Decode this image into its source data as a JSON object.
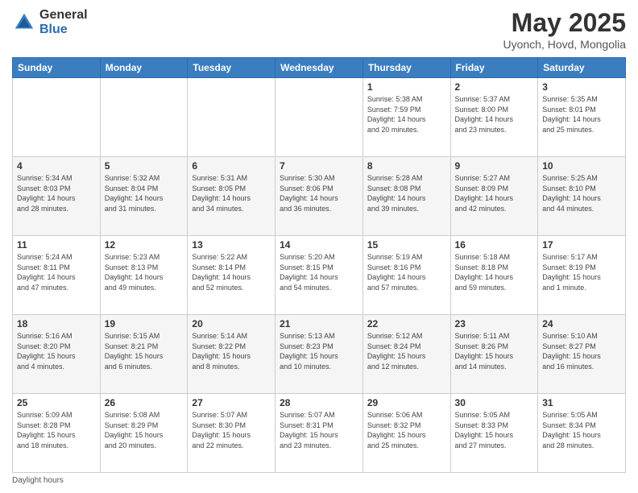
{
  "header": {
    "logo_general": "General",
    "logo_blue": "Blue",
    "title": "May 2025",
    "location": "Uyonch, Hovd, Mongolia"
  },
  "weekdays": [
    "Sunday",
    "Monday",
    "Tuesday",
    "Wednesday",
    "Thursday",
    "Friday",
    "Saturday"
  ],
  "footer": "Daylight hours",
  "weeks": [
    [
      {
        "day": "",
        "info": ""
      },
      {
        "day": "",
        "info": ""
      },
      {
        "day": "",
        "info": ""
      },
      {
        "day": "",
        "info": ""
      },
      {
        "day": "1",
        "info": "Sunrise: 5:38 AM\nSunset: 7:59 PM\nDaylight: 14 hours\nand 20 minutes."
      },
      {
        "day": "2",
        "info": "Sunrise: 5:37 AM\nSunset: 8:00 PM\nDaylight: 14 hours\nand 23 minutes."
      },
      {
        "day": "3",
        "info": "Sunrise: 5:35 AM\nSunset: 8:01 PM\nDaylight: 14 hours\nand 25 minutes."
      }
    ],
    [
      {
        "day": "4",
        "info": "Sunrise: 5:34 AM\nSunset: 8:03 PM\nDaylight: 14 hours\nand 28 minutes."
      },
      {
        "day": "5",
        "info": "Sunrise: 5:32 AM\nSunset: 8:04 PM\nDaylight: 14 hours\nand 31 minutes."
      },
      {
        "day": "6",
        "info": "Sunrise: 5:31 AM\nSunset: 8:05 PM\nDaylight: 14 hours\nand 34 minutes."
      },
      {
        "day": "7",
        "info": "Sunrise: 5:30 AM\nSunset: 8:06 PM\nDaylight: 14 hours\nand 36 minutes."
      },
      {
        "day": "8",
        "info": "Sunrise: 5:28 AM\nSunset: 8:08 PM\nDaylight: 14 hours\nand 39 minutes."
      },
      {
        "day": "9",
        "info": "Sunrise: 5:27 AM\nSunset: 8:09 PM\nDaylight: 14 hours\nand 42 minutes."
      },
      {
        "day": "10",
        "info": "Sunrise: 5:25 AM\nSunset: 8:10 PM\nDaylight: 14 hours\nand 44 minutes."
      }
    ],
    [
      {
        "day": "11",
        "info": "Sunrise: 5:24 AM\nSunset: 8:11 PM\nDaylight: 14 hours\nand 47 minutes."
      },
      {
        "day": "12",
        "info": "Sunrise: 5:23 AM\nSunset: 8:13 PM\nDaylight: 14 hours\nand 49 minutes."
      },
      {
        "day": "13",
        "info": "Sunrise: 5:22 AM\nSunset: 8:14 PM\nDaylight: 14 hours\nand 52 minutes."
      },
      {
        "day": "14",
        "info": "Sunrise: 5:20 AM\nSunset: 8:15 PM\nDaylight: 14 hours\nand 54 minutes."
      },
      {
        "day": "15",
        "info": "Sunrise: 5:19 AM\nSunset: 8:16 PM\nDaylight: 14 hours\nand 57 minutes."
      },
      {
        "day": "16",
        "info": "Sunrise: 5:18 AM\nSunset: 8:18 PM\nDaylight: 14 hours\nand 59 minutes."
      },
      {
        "day": "17",
        "info": "Sunrise: 5:17 AM\nSunset: 8:19 PM\nDaylight: 15 hours\nand 1 minute."
      }
    ],
    [
      {
        "day": "18",
        "info": "Sunrise: 5:16 AM\nSunset: 8:20 PM\nDaylight: 15 hours\nand 4 minutes."
      },
      {
        "day": "19",
        "info": "Sunrise: 5:15 AM\nSunset: 8:21 PM\nDaylight: 15 hours\nand 6 minutes."
      },
      {
        "day": "20",
        "info": "Sunrise: 5:14 AM\nSunset: 8:22 PM\nDaylight: 15 hours\nand 8 minutes."
      },
      {
        "day": "21",
        "info": "Sunrise: 5:13 AM\nSunset: 8:23 PM\nDaylight: 15 hours\nand 10 minutes."
      },
      {
        "day": "22",
        "info": "Sunrise: 5:12 AM\nSunset: 8:24 PM\nDaylight: 15 hours\nand 12 minutes."
      },
      {
        "day": "23",
        "info": "Sunrise: 5:11 AM\nSunset: 8:26 PM\nDaylight: 15 hours\nand 14 minutes."
      },
      {
        "day": "24",
        "info": "Sunrise: 5:10 AM\nSunset: 8:27 PM\nDaylight: 15 hours\nand 16 minutes."
      }
    ],
    [
      {
        "day": "25",
        "info": "Sunrise: 5:09 AM\nSunset: 8:28 PM\nDaylight: 15 hours\nand 18 minutes."
      },
      {
        "day": "26",
        "info": "Sunrise: 5:08 AM\nSunset: 8:29 PM\nDaylight: 15 hours\nand 20 minutes."
      },
      {
        "day": "27",
        "info": "Sunrise: 5:07 AM\nSunset: 8:30 PM\nDaylight: 15 hours\nand 22 minutes."
      },
      {
        "day": "28",
        "info": "Sunrise: 5:07 AM\nSunset: 8:31 PM\nDaylight: 15 hours\nand 23 minutes."
      },
      {
        "day": "29",
        "info": "Sunrise: 5:06 AM\nSunset: 8:32 PM\nDaylight: 15 hours\nand 25 minutes."
      },
      {
        "day": "30",
        "info": "Sunrise: 5:05 AM\nSunset: 8:33 PM\nDaylight: 15 hours\nand 27 minutes."
      },
      {
        "day": "31",
        "info": "Sunrise: 5:05 AM\nSunset: 8:34 PM\nDaylight: 15 hours\nand 28 minutes."
      }
    ]
  ]
}
